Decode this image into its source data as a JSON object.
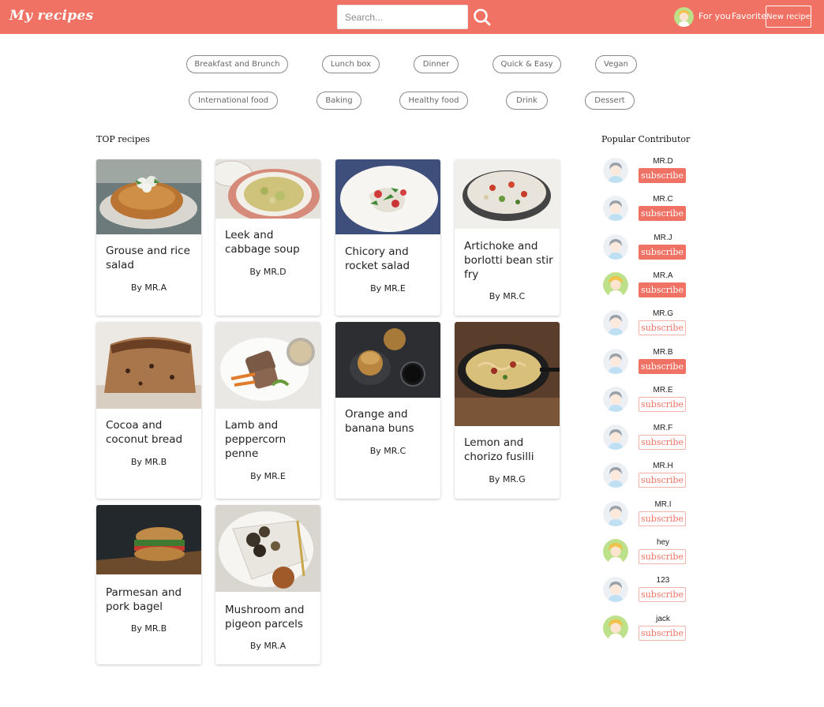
{
  "header": {
    "brand": "My recipes",
    "search_placeholder": "Search...",
    "nav_for_you": "For you",
    "nav_favorite": "Favorite",
    "new_recipe": "New recipe",
    "accent_color": "#f07264"
  },
  "categories": [
    "Breakfast and Brunch",
    "Lunch box",
    "Dinner",
    "Quick & Easy",
    "Vegan",
    "International food",
    "Baking",
    "Healthy food",
    "Drink",
    "Dessert"
  ],
  "top_recipes": {
    "title": "TOP recipes",
    "cards": [
      {
        "title": "Grouse and rice salad",
        "author": "By MR.A"
      },
      {
        "title": "Leek and cabbage soup",
        "author": "By MR.D"
      },
      {
        "title": "Chicory and rocket salad",
        "author": "By MR.E"
      },
      {
        "title": "Artichoke and borlotti bean stir fry",
        "author": "By MR.C"
      },
      {
        "title": "Cocoa and coconut bread",
        "author": "By MR.B"
      },
      {
        "title": "Lamb and peppercorn penne",
        "author": "By MR.E"
      },
      {
        "title": "Orange and banana buns",
        "author": "By MR.C"
      },
      {
        "title": "Lemon and chorizo fusilli",
        "author": "By MR.G"
      },
      {
        "title": "Parmesan and pork bagel",
        "author": "By MR.B"
      },
      {
        "title": "Mushroom and pigeon parcels",
        "author": "By MR.A"
      }
    ]
  },
  "contributors": {
    "title": "Popular Contributor",
    "subscribe_label": "subscribe",
    "items": [
      {
        "name": "MR.D",
        "subscribed": true,
        "avatar": "grey-avatar-icon"
      },
      {
        "name": "MR.C",
        "subscribed": true,
        "avatar": "grey-avatar-icon"
      },
      {
        "name": "MR.J",
        "subscribed": true,
        "avatar": "grey-avatar-icon"
      },
      {
        "name": "MR.A",
        "subscribed": true,
        "avatar": "blonde-avatar-icon"
      },
      {
        "name": "MR.G",
        "subscribed": false,
        "avatar": "grey-avatar-icon"
      },
      {
        "name": "MR.B",
        "subscribed": true,
        "avatar": "grey-avatar-icon"
      },
      {
        "name": "MR.E",
        "subscribed": false,
        "avatar": "grey-avatar-icon"
      },
      {
        "name": "MR.F",
        "subscribed": false,
        "avatar": "grey-avatar-icon"
      },
      {
        "name": "MR.H",
        "subscribed": false,
        "avatar": "grey-avatar-icon"
      },
      {
        "name": "MR.I",
        "subscribed": false,
        "avatar": "grey-avatar-icon"
      },
      {
        "name": "hey",
        "subscribed": false,
        "avatar": "blonde-avatar-icon"
      },
      {
        "name": "123",
        "subscribed": false,
        "avatar": "grey-avatar-icon"
      },
      {
        "name": "jack",
        "subscribed": false,
        "avatar": "blonde-avatar-icon"
      }
    ]
  }
}
